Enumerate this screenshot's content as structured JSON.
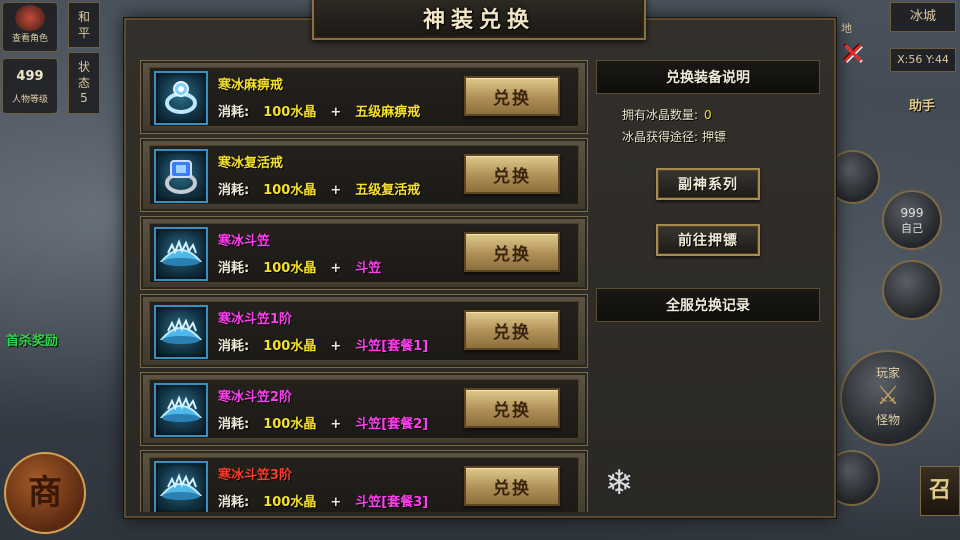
{
  "window": {
    "title": "神装兑换",
    "close_symbol": "✕"
  },
  "hud": {
    "view_character": "查看角色",
    "level_value": "499",
    "level_label": "人物等级",
    "mode_peace": "和平",
    "state_label": "状态",
    "state_value": "5",
    "first_kill_reward": "首杀奖励",
    "shop_label": "商",
    "map_name": "冰城",
    "coordinates": "X:56 Y:44",
    "assist_label": "助手",
    "right_counter": "999",
    "right_self": "自己",
    "player_label": "玩家",
    "monster_label": "怪物",
    "right_bottom_glyph": "召",
    "map_label_short": "地"
  },
  "list": {
    "items": [
      {
        "name": "寒冰麻痹戒",
        "name_color": "#f5e12a",
        "cost_label": "消耗:",
        "cost_amount": "100水晶",
        "plus": "+",
        "material": "五级麻痹戒",
        "material_color": "#f5e12a",
        "button_label": "兑换",
        "icon": "ring-icon"
      },
      {
        "name": "寒冰复活戒",
        "name_color": "#f5e12a",
        "cost_label": "消耗:",
        "cost_amount": "100水晶",
        "plus": "+",
        "material": "五级复活戒",
        "material_color": "#f5e12a",
        "button_label": "兑换",
        "icon": "gem-ring-icon"
      },
      {
        "name": "寒冰斗笠",
        "name_color": "#ff3ef0",
        "cost_label": "消耗:",
        "cost_amount": "100水晶",
        "plus": "+",
        "material": "斗笠",
        "material_color": "#ff3ef0",
        "button_label": "兑换",
        "icon": "hat-icon"
      },
      {
        "name": "寒冰斗笠1阶",
        "name_color": "#ff3ef0",
        "cost_label": "消耗:",
        "cost_amount": "100水晶",
        "plus": "+",
        "material": "斗笠[套餐1]",
        "material_color": "#ff3ef0",
        "button_label": "兑换",
        "icon": "hat-icon"
      },
      {
        "name": "寒冰斗笠2阶",
        "name_color": "#ff3ef0",
        "cost_label": "消耗:",
        "cost_amount": "100水晶",
        "plus": "+",
        "material": "斗笠[套餐2]",
        "material_color": "#ff3ef0",
        "button_label": "兑换",
        "icon": "hat-icon"
      },
      {
        "name": "寒冰斗笠3阶",
        "name_color": "#ff3a2a",
        "cost_label": "消耗:",
        "cost_amount": "100水晶",
        "plus": "+",
        "material": "斗笠[套餐3]",
        "material_color": "#ff3ef0",
        "button_label": "兑换",
        "icon": "hat-icon"
      }
    ]
  },
  "side": {
    "header": "兑换装备说明",
    "crystal_count_label": "拥有冰晶数量:",
    "crystal_count_value": "0",
    "crystal_source_label": "冰晶获得途径:",
    "crystal_source_value": "押镖",
    "btn_series": "副神系列",
    "btn_escort": "前往押镖",
    "records_header": "全服兑换记录"
  },
  "colors": {
    "accent_gold": "#f5e12a",
    "accent_magenta": "#ff3ef0",
    "accent_red": "#ff3a2a",
    "panel_border": "#8a7040"
  }
}
